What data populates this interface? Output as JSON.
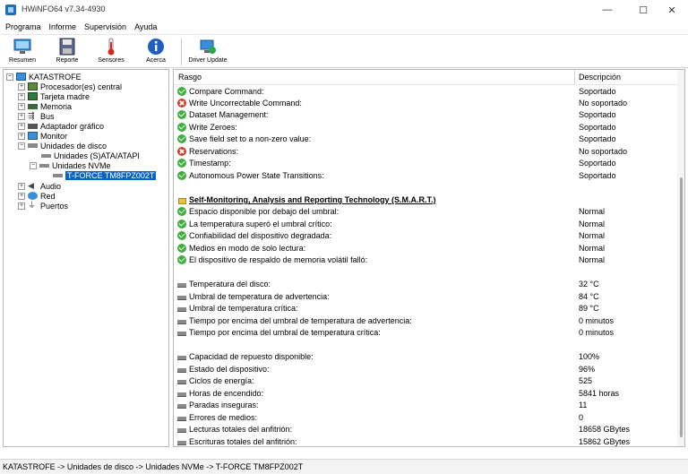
{
  "window": {
    "title": "HWiNFO64 v7.34-4930"
  },
  "menu": [
    "Programa",
    "Informe",
    "Supervisión",
    "Ayuda"
  ],
  "toolbar": {
    "resumen": "Resumen",
    "reporte": "Reporte",
    "sensores": "Sensores",
    "acerca": "Acerca",
    "driver_update": "Driver Update"
  },
  "tree": {
    "root": "KATASTROFE",
    "items": [
      "Procesador(es) central",
      "Tarjeta madre",
      "Memoria",
      "Bus",
      "Adaptador gráfico",
      "Monitor",
      "Unidades de disco",
      "Unidades (S)ATA/ATAPI",
      "Unidades NVMe",
      "T-FORCE TM8FPZ002T",
      "Audio",
      "Red",
      "Puertos"
    ]
  },
  "details": {
    "col_feature": "Rasgo",
    "col_desc": "Descripción",
    "commands": [
      {
        "name": "Compare Command:",
        "value": "Soportado",
        "status": "ok"
      },
      {
        "name": "Write Uncorrectable Command:",
        "value": "No soportado",
        "status": "bad"
      },
      {
        "name": "Dataset Management:",
        "value": "Soportado",
        "status": "ok"
      },
      {
        "name": "Write Zeroes:",
        "value": "Soportado",
        "status": "ok"
      },
      {
        "name": "Save field set to a non-zero value:",
        "value": "Soportado",
        "status": "ok"
      },
      {
        "name": "Reservations:",
        "value": "No soportado",
        "status": "bad"
      },
      {
        "name": "Timestamp:",
        "value": "Soportado",
        "status": "ok"
      },
      {
        "name": "Autonomous Power State Transitions:",
        "value": "Soportado",
        "status": "ok"
      }
    ],
    "smart_title": "Self-Monitoring, Analysis and Reporting Technology (S.M.A.R.T.)",
    "smart_checks": [
      {
        "name": "Espacio disponible por debajo del umbral:",
        "value": "Normal"
      },
      {
        "name": "La temperatura superó el umbral crítico:",
        "value": "Normal"
      },
      {
        "name": "Confiabilidad del dispositivo degradada:",
        "value": "Normal"
      },
      {
        "name": "Medios en modo de solo lectura:",
        "value": "Normal"
      },
      {
        "name": "El dispositivo de respaldo de memoria volátil falló:",
        "value": "Normal"
      }
    ],
    "temperatures": [
      {
        "name": "Temperatura del disco:",
        "value": "32 °C"
      },
      {
        "name": "Umbral de temperatura de advertencia:",
        "value": "84 °C"
      },
      {
        "name": "Umbral de temperatura crítica:",
        "value": "89 °C"
      },
      {
        "name": "Tiempo por encima del umbral de temperatura de advertencia:",
        "value": "0 minutos"
      },
      {
        "name": "Tiempo por encima del umbral de temperatura crítica:",
        "value": "0 minutos"
      }
    ],
    "health": [
      {
        "name": "Capacidad de repuesto disponible:",
        "value": "100%"
      },
      {
        "name": "Estado del dispositivo:",
        "value": "96%"
      },
      {
        "name": "Ciclos de energía:",
        "value": "525"
      },
      {
        "name": "Horas de encendido:",
        "value": "5841 horas"
      },
      {
        "name": "Paradas inseguras:",
        "value": "11"
      },
      {
        "name": "Errores de medios:",
        "value": "0"
      },
      {
        "name": "Lecturas totales del anfitrión:",
        "value": "18658 GBytes"
      },
      {
        "name": "Escrituras totales del anfitrión:",
        "value": "15862 GBytes"
      }
    ]
  },
  "status_bar": "KATASTROFE -> Unidades de disco -> Unidades NVMe -> T-FORCE TM8FPZ002T"
}
